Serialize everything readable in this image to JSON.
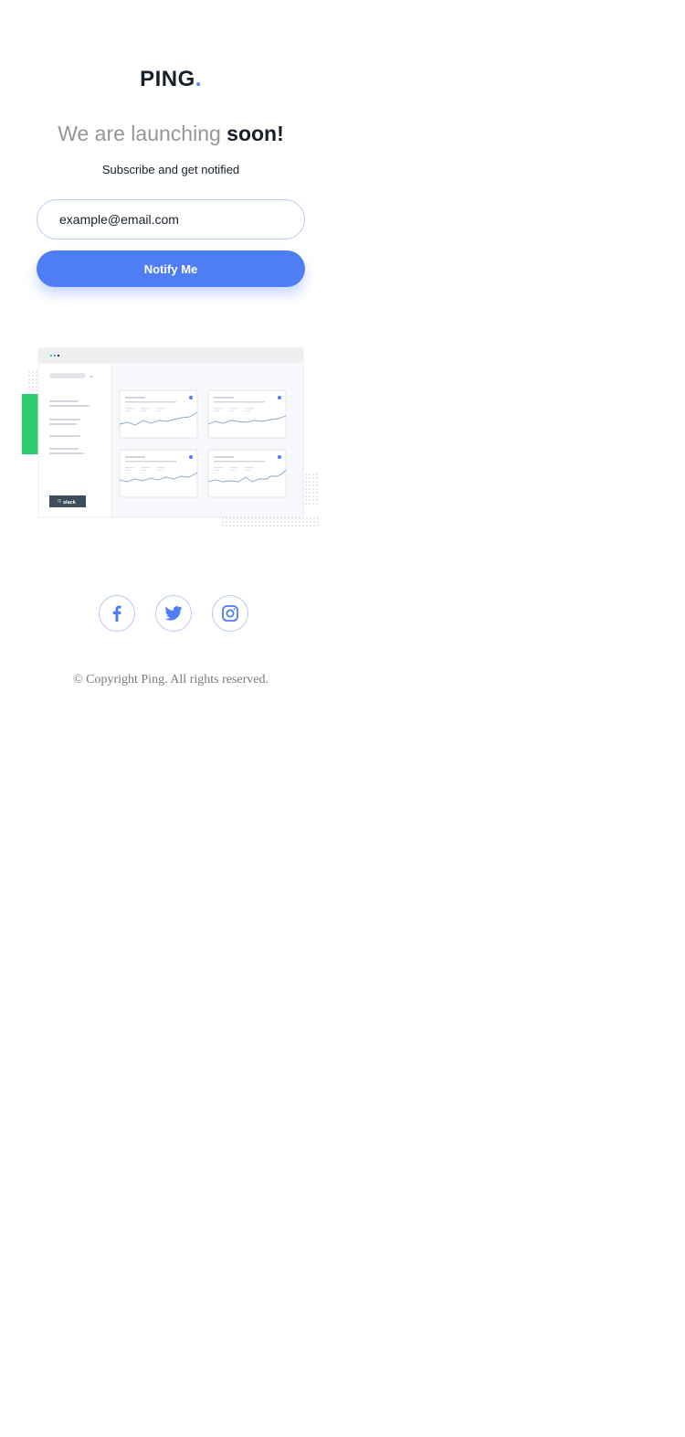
{
  "brand": {
    "name": "PING",
    "dot": ".",
    "dot_color": "#4d7ef5"
  },
  "hero": {
    "headline_light": "We are launching ",
    "headline_bold": "soon!",
    "subtext": "Subscribe and get notified"
  },
  "form": {
    "email_placeholder": "example@email.com",
    "notify_label": "Notify Me"
  },
  "illustration": {
    "badge_label": "slack"
  },
  "social": [
    {
      "name": "facebook",
      "icon": "facebook-icon"
    },
    {
      "name": "twitter",
      "icon": "twitter-icon"
    },
    {
      "name": "instagram",
      "icon": "instagram-icon"
    }
  ],
  "footer": {
    "copyright": "© Copyright Ping. All rights reserved."
  },
  "colors": {
    "accent": "#4f7df3",
    "text": "#15202b",
    "muted": "#969696",
    "green": "#2ecc71"
  }
}
